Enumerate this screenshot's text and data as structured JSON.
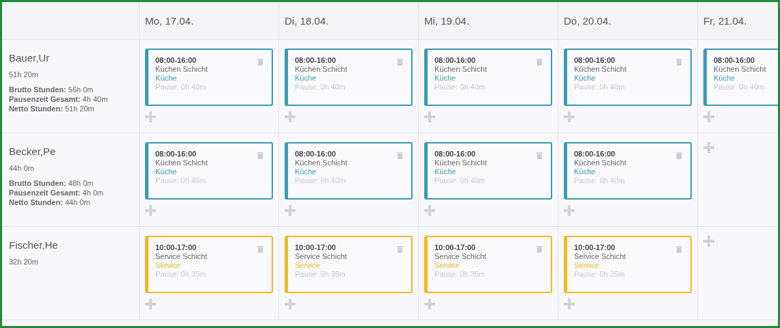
{
  "days": [
    "Mo, 17.04.",
    "Di, 18.04.",
    "Mi, 19.04.",
    "Do, 20.04.",
    "Fr, 21.04."
  ],
  "employees": [
    {
      "name": "Bauer,Ur",
      "hours": "51h 20m",
      "stats": [
        {
          "label": "Brutto Stunden:",
          "value": "56h 0m"
        },
        {
          "label": "Pausenzeit Gesamt:",
          "value": "4h 40m"
        },
        {
          "label": "Netto Stunden:",
          "value": "51h 20m"
        }
      ],
      "cells": [
        {
          "kind": "shift",
          "time": "08:00-16:00",
          "title": "Küchen Schicht",
          "area": "Küche",
          "pause": "Pause: 0h 40m",
          "color": "#3a9bb5"
        },
        {
          "kind": "shift",
          "time": "08:00-16:00",
          "title": "Küchen Schicht",
          "area": "Küche",
          "pause": "Pause: 0h 40m",
          "color": "#3a9bb5"
        },
        {
          "kind": "shift",
          "time": "08:00-16:00",
          "title": "Küchen Schicht",
          "area": "Küche",
          "pause": "Pause: 0h 40m",
          "color": "#3a9bb5"
        },
        {
          "kind": "shift",
          "time": "08:00-16:00",
          "title": "Küchen Schicht",
          "area": "Küche",
          "pause": "Pause: 0h 40m",
          "color": "#3a9bb5"
        },
        {
          "kind": "shift",
          "time": "08:00-16:00",
          "title": "Küchen Schicht",
          "area": "Küche",
          "pause": "Pause: 0h 40m",
          "color": "#3a9bb5"
        }
      ]
    },
    {
      "name": "Becker,Pe",
      "hours": "44h 0m",
      "stats": [
        {
          "label": "Brutto Stunden:",
          "value": "48h 0m"
        },
        {
          "label": "Pausenzeit Gesamt:",
          "value": "4h 0m"
        },
        {
          "label": "Netto Stunden:",
          "value": "44h 0m"
        }
      ],
      "cells": [
        {
          "kind": "shift",
          "time": "08:00-16:00",
          "title": "Küchen Schicht",
          "area": "Küche",
          "pause": "Pause: 0h 40m",
          "color": "#3a9bb5"
        },
        {
          "kind": "shift",
          "time": "08:00-16:00",
          "title": "Küchen Schicht",
          "area": "Küche",
          "pause": "Pause: 0h 40m",
          "color": "#3a9bb5"
        },
        {
          "kind": "shift",
          "time": "08:00-16:00",
          "title": "Küchen Schicht",
          "area": "Küche",
          "pause": "Pause: 0h 40m",
          "color": "#3a9bb5"
        },
        {
          "kind": "shift",
          "time": "08:00-16:00",
          "title": "Küchen Schicht",
          "area": "Küche",
          "pause": "Pause: 0h 40m",
          "color": "#3a9bb5"
        },
        {
          "kind": "empty"
        }
      ]
    },
    {
      "name": "Fischer,He",
      "hours": "32h 20m",
      "cells": [
        {
          "kind": "shift",
          "time": "10:00-17:00",
          "title": "Service Schicht",
          "area": "Service",
          "pause": "Pause: 0h 35m",
          "color": "#f0b921"
        },
        {
          "kind": "shift",
          "time": "10:00-17:00",
          "title": "Service Schicht",
          "area": "Service",
          "pause": "Pause: 0h 35m",
          "color": "#f0b921"
        },
        {
          "kind": "shift",
          "time": "10:00-17:00",
          "title": "Service Schicht",
          "area": "Service",
          "pause": "Pause: 0h 35m",
          "color": "#f0b921"
        },
        {
          "kind": "shift",
          "time": "10:00-17:00",
          "title": "Service Schicht",
          "area": "Service",
          "pause": "Pause: 0h 35m",
          "color": "#f0b921"
        },
        {
          "kind": "empty"
        }
      ]
    }
  ]
}
